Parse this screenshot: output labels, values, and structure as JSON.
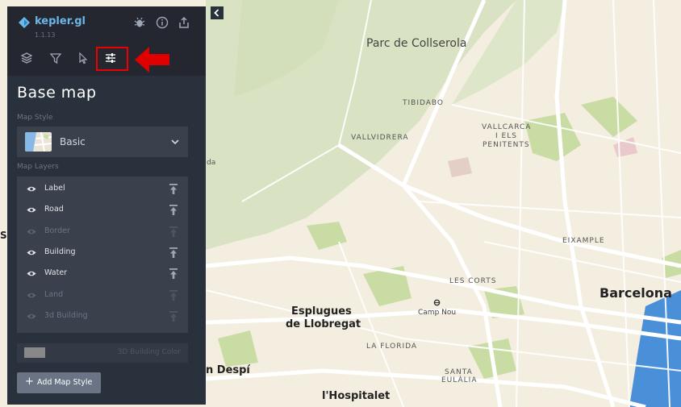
{
  "app": {
    "name": "kepler.gl",
    "version": "1.1.13"
  },
  "header_icons": [
    "bug-icon",
    "info-icon",
    "share-icon"
  ],
  "tabs": [
    {
      "name": "layers",
      "icon": "layers-icon",
      "active": false
    },
    {
      "name": "filters",
      "icon": "filter-icon",
      "active": false
    },
    {
      "name": "interactions",
      "icon": "cursor-icon",
      "active": false
    },
    {
      "name": "base-map",
      "icon": "sliders-icon",
      "active": true
    }
  ],
  "panel": {
    "title": "Base map",
    "map_style_label": "Map Style",
    "selected_style": "Basic",
    "map_layers_label": "Map Layers",
    "layers": [
      {
        "label": "Label",
        "visible": true
      },
      {
        "label": "Road",
        "visible": true
      },
      {
        "label": "Border",
        "visible": false
      },
      {
        "label": "Building",
        "visible": true
      },
      {
        "label": "Water",
        "visible": true
      },
      {
        "label": "Land",
        "visible": false
      },
      {
        "label": "3d Building",
        "visible": false
      }
    ],
    "building_color_label": "3D Building Color",
    "building_color": "#888888",
    "add_map_style_label": "Add Map Style",
    "add_icon": "+"
  },
  "map": {
    "labels": {
      "collserola": "Parc de Collserola",
      "tibidabo": "TIBIDABO",
      "vallvidrera": "VALLVIDRERA",
      "vallcarca1": "VALLCARCA",
      "vallcarca2": "I ELS",
      "vallcarca3": "PENITENTS",
      "eixample": "EIXAMPLE",
      "les_corts": "LES CORTS",
      "barcelona": "Barcelona",
      "camp_nou": "Camp Nou",
      "esplugues1": "Esplugues",
      "esplugues2": "de Llobregat",
      "la_florida": "LA FLORIDA",
      "santa1": "SANTA",
      "santa2": "EULÀLIA",
      "hospitalet": "l'Hospitalet",
      "despi": "n Despí",
      "da": "da",
      "s": "S"
    }
  },
  "colors": {
    "accent": "#6cb7e8",
    "panel_bg": "#29323c",
    "header_bg": "#242730",
    "highlight": "#e00000",
    "map_bg": "#f3eedf",
    "water": "#4a90d9"
  }
}
